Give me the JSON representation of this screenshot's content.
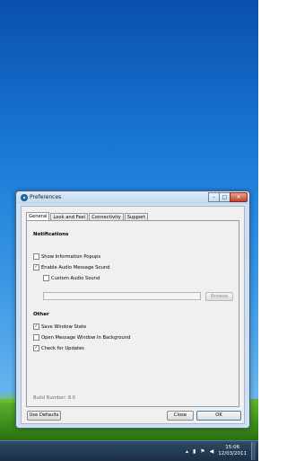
{
  "window": {
    "title": "Preferences",
    "caption_minimize": "–",
    "caption_maximize": "□",
    "caption_close": "✕"
  },
  "tabs": [
    {
      "label": "General",
      "active": true
    },
    {
      "label": "Look and Feel",
      "active": false
    },
    {
      "label": "Connectivity",
      "active": false
    },
    {
      "label": "Support",
      "active": false
    }
  ],
  "notifications": {
    "heading": "Notifications",
    "show_popups": {
      "label": "Show Information Popups",
      "checked": false
    },
    "enable_audio": {
      "label": "Enable Audio Message Sound",
      "checked": true
    },
    "custom_audio": {
      "label": "Custom Audio Sound",
      "checked": false
    },
    "audio_path": "",
    "browse_label": "Browse"
  },
  "other": {
    "heading": "Other",
    "save_window_state": {
      "label": "Save Window State",
      "checked": true
    },
    "open_in_background": {
      "label": "Open Message Window In Background",
      "checked": false
    },
    "check_updates": {
      "label": "Check for Updates",
      "checked": true
    }
  },
  "build_number": "Build Number: 8.0",
  "footer": {
    "use_defaults": "Use Defaults",
    "close": "Close",
    "ok": "OK"
  },
  "taskbar": {
    "time": "15:06",
    "date": "12/03/2011",
    "tray_icons": [
      "show-hidden-icon",
      "network-icon",
      "flag-icon",
      "volume-icon"
    ],
    "tray_glyphs": [
      "▴",
      "▮",
      "⚑",
      "◀"
    ]
  },
  "colors": {
    "desktop_top": "#0a4fae",
    "desktop_bottom": "#79c2f3",
    "window_frame": "#cfe0f2",
    "taskbar": "#1b2f45",
    "close_button": "#c4412a"
  }
}
